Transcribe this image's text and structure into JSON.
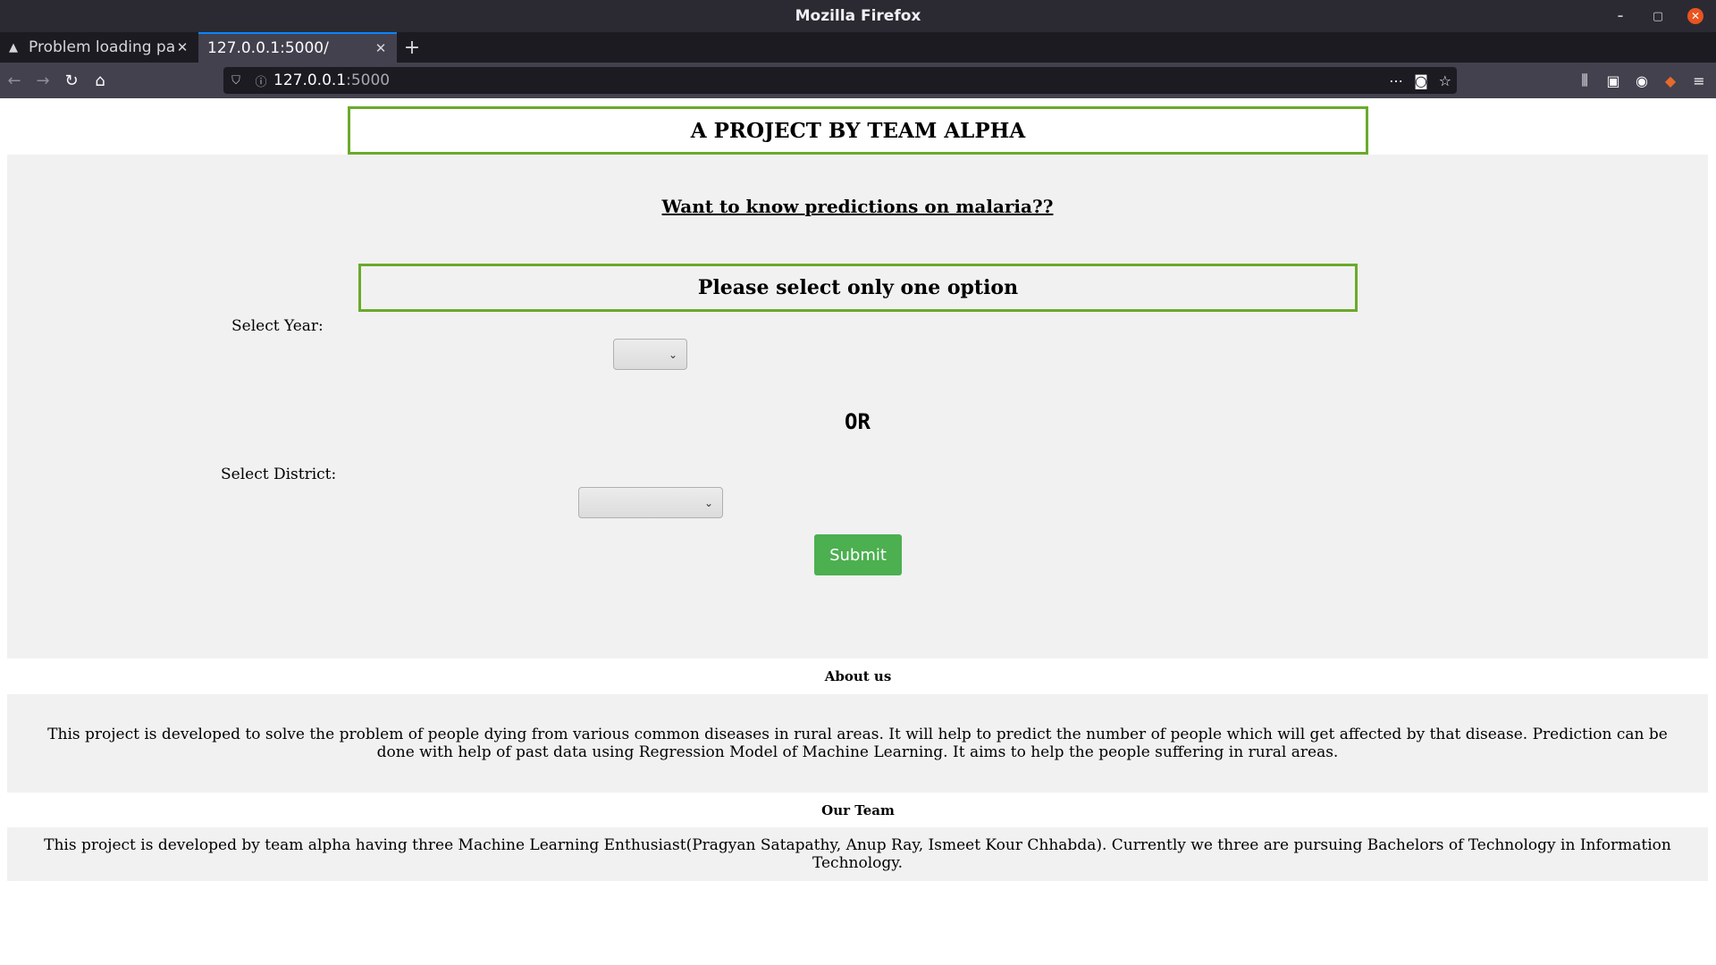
{
  "window": {
    "title": "Mozilla Firefox"
  },
  "tabs": [
    {
      "label": "Problem loading pa",
      "icon": "warning-icon",
      "active": false
    },
    {
      "label": "127.0.0.1:5000/",
      "icon": "",
      "active": true
    }
  ],
  "urlbar": {
    "host": "127.0.0.1",
    "port": ":5000"
  },
  "page": {
    "banner": "A PROJECT BY TEAM ALPHA",
    "question": "Want to know predictions on malaria??",
    "option_notice": "Please select only one option",
    "year_label": "Select Year:",
    "year_value": "",
    "or_text": "OR",
    "district_label": "Select District:",
    "district_value": "",
    "submit_label": "Submit",
    "about_heading": "About us",
    "about_text": "This project is developed to solve the problem of people dying from various common diseases in rural areas. It will help to predict the number of people which will get affected by that disease. Prediction can be done with help of past data using Regression Model of Machine Learning. It aims to help the people suffering in rural areas.",
    "team_heading": "Our Team",
    "team_text": "This project is developed by team alpha having three Machine Learning Enthusiast(Pragyan Satapathy, Anup Ray, Ismeet Kour Chhabda). Currently we three are pursuing Bachelors of Technology in Information Technology."
  },
  "colors": {
    "accent_border": "#6aaa2a",
    "submit_bg": "#4caf50",
    "panel_bg": "#f1f1f1",
    "close_button": "#e95420"
  }
}
